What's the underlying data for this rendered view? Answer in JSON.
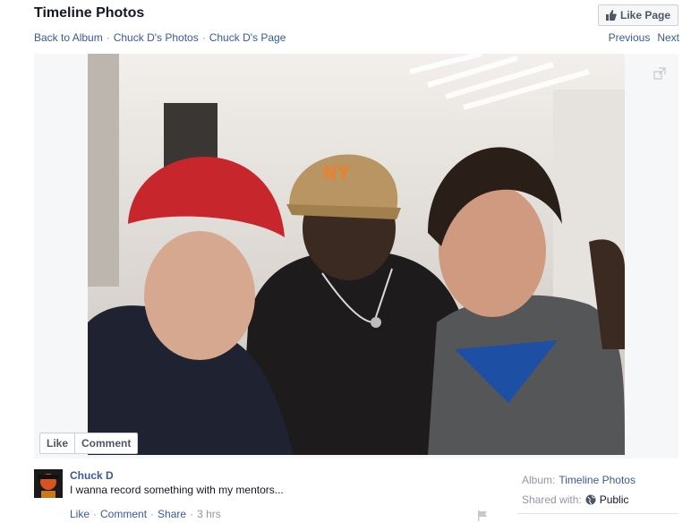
{
  "header": {
    "title": "Timeline Photos",
    "like_page_label": "Like Page"
  },
  "breadcrumb": {
    "back_to_album": "Back to Album",
    "photos": "Chuck D's Photos",
    "page": "Chuck D's Page",
    "separator": "·"
  },
  "pager": {
    "previous": "Previous",
    "next": "Next"
  },
  "photo_actions": {
    "like": "Like",
    "comment": "Comment"
  },
  "post": {
    "author": "Chuck D",
    "caption": "I wanna record something with my mentors...",
    "like": "Like",
    "comment": "Comment",
    "share": "Share",
    "separator": "·",
    "time": "3 hrs"
  },
  "meta": {
    "album_label": "Album:",
    "album_value": "Timeline Photos",
    "shared_label": "Shared with:",
    "shared_value": "Public"
  },
  "icons": {
    "like_page": "thumbs-up-icon",
    "expand": "expand-icon",
    "globe": "globe-icon",
    "flag": "flag-icon"
  },
  "colors": {
    "link": "#3b5998",
    "muted": "#9197a3",
    "border": "#cccfd6"
  }
}
